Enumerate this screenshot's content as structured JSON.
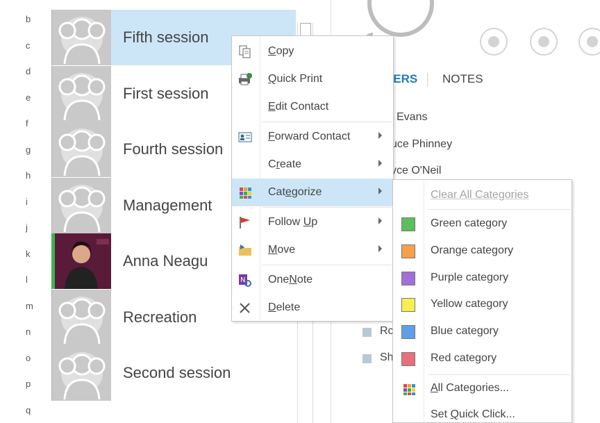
{
  "alphabet": [
    "b",
    "c",
    "d",
    "e",
    "f",
    "g",
    "h",
    "i",
    "j",
    "k",
    "l",
    "m",
    "n",
    "o",
    "p",
    "q"
  ],
  "contacts": [
    {
      "name": "Fifth session",
      "selected": true,
      "photo": false
    },
    {
      "name": "First session",
      "selected": false,
      "photo": false
    },
    {
      "name": "Fourth session",
      "selected": false,
      "photo": false
    },
    {
      "name": "Management",
      "selected": false,
      "photo": false
    },
    {
      "name": "Anna Neagu",
      "selected": false,
      "photo": true
    },
    {
      "name": "Recreation",
      "selected": false,
      "photo": false
    },
    {
      "name": "Second session",
      "selected": false,
      "photo": false
    }
  ],
  "right_pane": {
    "tabs": [
      {
        "label": "BERS",
        "active": true
      },
      {
        "label": "NOTES",
        "active": false
      }
    ],
    "members": [
      "l Evans",
      "uce Phinney",
      "yce O'Neil"
    ],
    "categories_list": [
      "Rc",
      "Sh"
    ],
    "action_icons": [
      "chat-icon",
      "phone-icon",
      "video-icon"
    ]
  },
  "context_menu": {
    "items": [
      {
        "pre": "",
        "key": "C",
        "post": "opy",
        "icon": "copy-icon",
        "submenu": false,
        "highlighted": false
      },
      {
        "pre": "",
        "key": "Q",
        "post": "uick Print",
        "icon": "printer-icon",
        "submenu": false,
        "highlighted": false
      },
      {
        "pre": "",
        "key": "E",
        "post": "dit Contact",
        "icon": "",
        "submenu": false,
        "highlighted": false
      },
      {
        "pre": "",
        "key": "F",
        "post": "orward Contact",
        "icon": "forward-contact-icon",
        "submenu": true,
        "highlighted": false
      },
      {
        "pre": "C",
        "key": "r",
        "post": "eate",
        "icon": "",
        "submenu": true,
        "highlighted": false
      },
      {
        "pre": "Cat",
        "key": "e",
        "post": "gorize",
        "icon": "categorize-icon",
        "submenu": true,
        "highlighted": true
      },
      {
        "pre": "Follow ",
        "key": "U",
        "post": "p",
        "icon": "flag-icon",
        "submenu": true,
        "highlighted": false
      },
      {
        "pre": "",
        "key": "M",
        "post": "ove",
        "icon": "move-icon",
        "submenu": true,
        "highlighted": false
      },
      {
        "pre": "One",
        "key": "N",
        "post": "ote",
        "icon": "onenote-icon",
        "submenu": false,
        "highlighted": false
      },
      {
        "pre": "",
        "key": "D",
        "post": "elete",
        "icon": "delete-icon",
        "submenu": false,
        "highlighted": false
      }
    ]
  },
  "categorize_submenu": {
    "clear_label": "Clear All Categories",
    "categories": [
      {
        "label": "Green category",
        "color": "#5cbf5c"
      },
      {
        "label": "Orange category",
        "color": "#f7a04b"
      },
      {
        "label": "Purple category",
        "color": "#a070d8"
      },
      {
        "label": "Yellow category",
        "color": "#f7ef4f"
      },
      {
        "label": "Blue category",
        "color": "#5f9ee8"
      },
      {
        "label": "Red category",
        "color": "#e8707a"
      }
    ],
    "all_categories": {
      "key": "A",
      "post": "ll Categories..."
    },
    "quick_click": {
      "pre": "Set ",
      "key": "Q",
      "post": "uick Click..."
    }
  },
  "colors": {
    "selection": "#cde6f7",
    "accent": "#1e7cc1",
    "placeholder_avatar": "#c9c9c9",
    "presence_green": "#3fb34f"
  }
}
